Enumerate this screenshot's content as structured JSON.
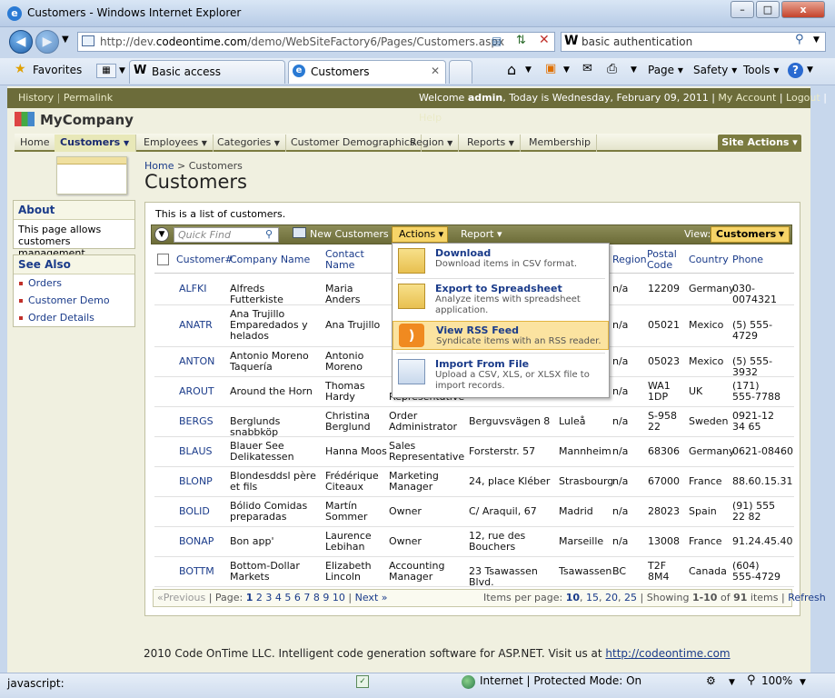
{
  "window": {
    "title": "Customers - Windows Internet Explorer",
    "min": "–",
    "max": "□",
    "close": "x"
  },
  "browser": {
    "url_prefix": "http://dev.",
    "url_host": "codeontime.com",
    "url_rest": "/demo/WebSiteFactory6/Pages/Customers.aspx",
    "search_value": "basic authentication",
    "favorites": "Favorites",
    "tab1": "Basic access authenticatio...",
    "tab2": "Customers",
    "page_menu": "Page ▾",
    "safety_menu": "Safety ▾",
    "tools_menu": "Tools ▾",
    "help": "?",
    "status_text": "javascript:",
    "zone": "Internet | Protected Mode: On",
    "zoom": "100%"
  },
  "topbar": {
    "history": "History",
    "permalink": "Permalink",
    "welcome_prefix": "Welcome ",
    "user": "admin",
    "welcome_suffix": ", Today is Wednesday, February 09, 2011 |",
    "my_account": "My Account",
    "logout": "Logout",
    "help": "Help"
  },
  "logo": "MyCompany",
  "menu": {
    "home": "Home",
    "customers": "Customers",
    "employees": "Employees",
    "categories": "Categories",
    "demographics": "Customer Demographics",
    "region": "Region",
    "reports": "Reports",
    "membership": "Membership",
    "site_actions": "Site Actions ▾"
  },
  "about": {
    "title": "About",
    "text": "This page allows customers management."
  },
  "see_also": {
    "title": "See Also",
    "items": [
      "Orders",
      "Customer Demo",
      "Order Details"
    ]
  },
  "breadcrumb": {
    "home": "Home",
    "sep": ">",
    "current": "Customers"
  },
  "page_title": "Customers",
  "description": "This is a list of customers.",
  "toolbar": {
    "quick_find": "Quick Find",
    "new": "New Customers",
    "actions": "Actions ▾",
    "report": "Report ▾",
    "view_label": "View:",
    "view_value": "Customers"
  },
  "columns": {
    "id": "Customer#",
    "company": "Company Name",
    "contact": "Contact Name",
    "region": "Region",
    "postal": "Postal Code",
    "country": "Country",
    "phone": "Phone"
  },
  "rows": [
    {
      "id": "ALFKI",
      "company": "Alfreds Futterkiste",
      "contact": "Maria Anders",
      "title": "",
      "address": "",
      "city": "",
      "region": "n/a",
      "postal": "12209",
      "country": "Germany",
      "phone": "030-0074321"
    },
    {
      "id": "ANATR",
      "company": "Ana Trujillo Emparedados y helados",
      "contact": "Ana Trujillo",
      "title": "",
      "address": "",
      "city": "",
      "region": "n/a",
      "postal": "05021",
      "country": "Mexico",
      "phone": "(5) 555-4729"
    },
    {
      "id": "ANTON",
      "company": "Antonio Moreno Taquería",
      "contact": "Antonio Moreno",
      "title": "",
      "address": "",
      "city": "",
      "region": "n/a",
      "postal": "05023",
      "country": "Mexico",
      "phone": "(5) 555-3932"
    },
    {
      "id": "AROUT",
      "company": "Around the Horn",
      "contact": "Thomas Hardy",
      "title": "Representative",
      "address": "",
      "city": "",
      "region": "n/a",
      "postal": "WA1 1DP",
      "country": "UK",
      "phone": "(171) 555-7788"
    },
    {
      "id": "BERGS",
      "company": "Berglunds snabbköp",
      "contact": "Christina Berglund",
      "title": "Order Administrator",
      "address": "Berguvsvägen 8",
      "city": "Luleå",
      "region": "n/a",
      "postal": "S-958 22",
      "country": "Sweden",
      "phone": "0921-12 34 65"
    },
    {
      "id": "BLAUS",
      "company": "Blauer See Delikatessen",
      "contact": "Hanna Moos",
      "title": "Sales Representative",
      "address": "Forsterstr. 57",
      "city": "Mannheim",
      "region": "n/a",
      "postal": "68306",
      "country": "Germany",
      "phone": "0621-08460"
    },
    {
      "id": "BLONP",
      "company": "Blondesddsl père et fils",
      "contact": "Frédérique Citeaux",
      "title": "Marketing Manager",
      "address": "24, place Kléber",
      "city": "Strasbourg",
      "region": "n/a",
      "postal": "67000",
      "country": "France",
      "phone": "88.60.15.31"
    },
    {
      "id": "BOLID",
      "company": "Bólido Comidas preparadas",
      "contact": "Martín Sommer",
      "title": "Owner",
      "address": "C/ Araquil, 67",
      "city": "Madrid",
      "region": "n/a",
      "postal": "28023",
      "country": "Spain",
      "phone": "(91) 555 22 82"
    },
    {
      "id": "BONAP",
      "company": "Bon app'",
      "contact": "Laurence Lebihan",
      "title": "Owner",
      "address": "12, rue des Bouchers",
      "city": "Marseille",
      "region": "n/a",
      "postal": "13008",
      "country": "France",
      "phone": "91.24.45.40"
    },
    {
      "id": "BOTTM",
      "company": "Bottom-Dollar Markets",
      "contact": "Elizabeth Lincoln",
      "title": "Accounting Manager",
      "address": "23 Tsawassen Blvd.",
      "city": "Tsawassen",
      "region": "BC",
      "postal": "T2F 8M4",
      "country": "Canada",
      "phone": "(604) 555-4729"
    }
  ],
  "pager": {
    "prev": "«Previous",
    "page_label": "| Page:",
    "pages": [
      "1",
      "2",
      "3",
      "4",
      "5",
      "6",
      "7",
      "8",
      "9",
      "10"
    ],
    "next": "Next »",
    "per_page": "Items per page:",
    "sizes": [
      "10",
      "15",
      "20",
      "25"
    ],
    "showing": "| Showing",
    "range": "1-10",
    "of": "of",
    "total": "91",
    "items": "items |",
    "refresh": "Refresh"
  },
  "actions_menu": [
    {
      "title": "Download",
      "desc": "Download items in CSV format."
    },
    {
      "title": "Export to Spreadsheet",
      "desc": "Analyze items with spreadsheet application."
    },
    {
      "title": "View RSS Feed",
      "desc": "Syndicate items with an RSS reader."
    },
    {
      "title": "Import From File",
      "desc": "Upload a CSV, XLS, or XLSX file to import records."
    }
  ],
  "footer": {
    "text": "2010 Code OnTime LLC. Intelligent code generation software for ASP.NET. Visit us at ",
    "link": "http://codeontime.com"
  }
}
